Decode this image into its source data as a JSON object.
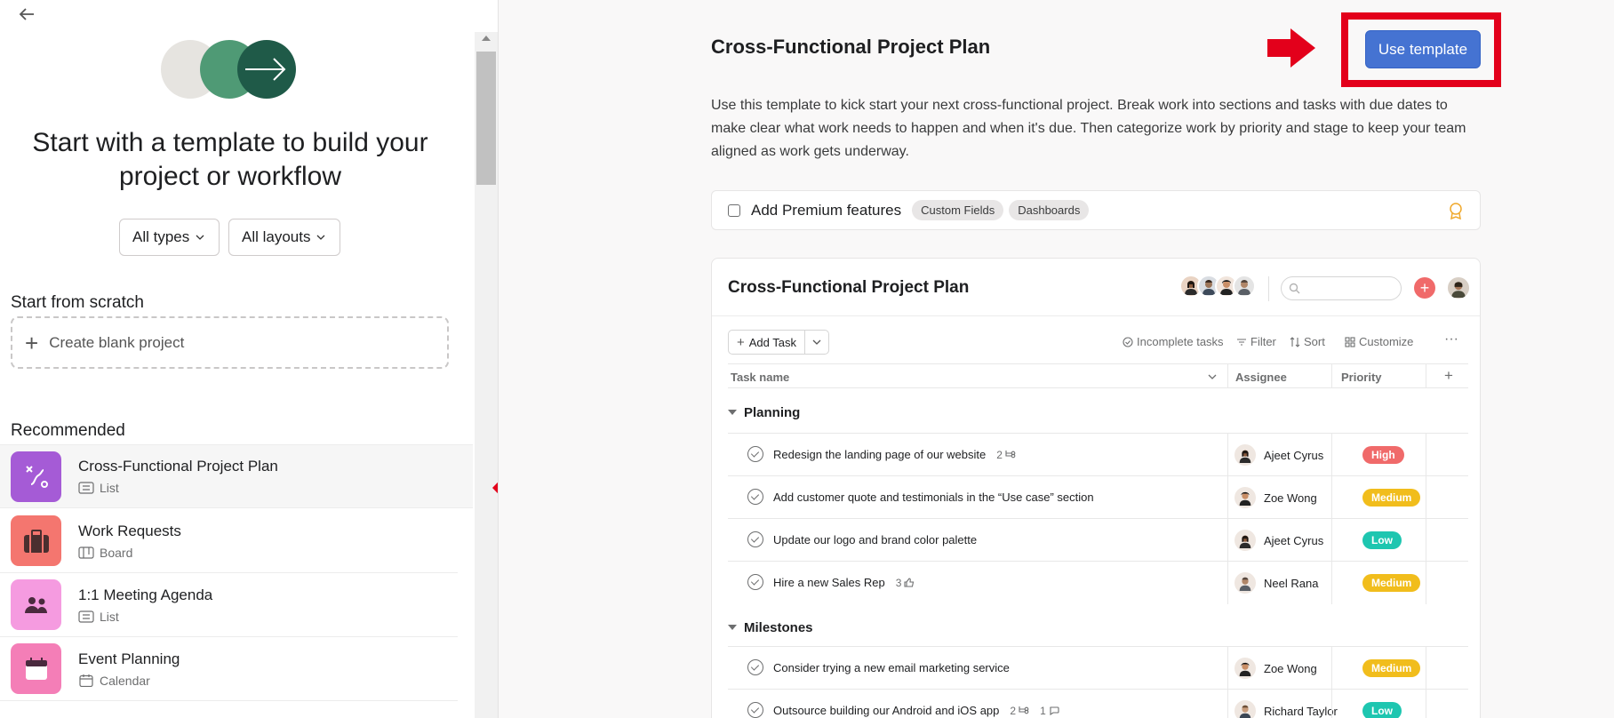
{
  "left": {
    "back_label": "Back",
    "hero_title": "Start with a template to build your project or workflow",
    "filter_types": "All types",
    "filter_layouts": "All layouts",
    "scratch_title": "Start from scratch",
    "blank_label": "Create blank project",
    "recommended_title": "Recommended",
    "templates": [
      {
        "name": "Cross-Functional Project Plan",
        "view": "List",
        "icon": "project-plan-icon",
        "color": "#a55bd6"
      },
      {
        "name": "Work Requests",
        "view": "Board",
        "icon": "briefcase-icon",
        "color": "#f4766f"
      },
      {
        "name": "1:1 Meeting Agenda",
        "view": "List",
        "icon": "people-icon",
        "color": "#f59be0"
      },
      {
        "name": "Event Planning",
        "view": "Calendar",
        "icon": "calendar-icon",
        "color": "#f47eb7"
      }
    ]
  },
  "detail": {
    "title": "Cross-Functional Project Plan",
    "use_template_label": "Use template",
    "description": "Use this template to kick start your next cross-functional project. Break work into sections and tasks with due dates to make clear what work needs to happen and when it's due. Then categorize work by priority and stage to keep your team aligned as work gets underway.",
    "premium_label": "Add Premium features",
    "premium_chips": [
      "Custom Fields",
      "Dashboards"
    ]
  },
  "preview": {
    "title": "Cross-Functional Project Plan",
    "add_task_label": "Add Task",
    "tools": [
      "Incomplete tasks",
      "Filter",
      "Sort",
      "Customize"
    ],
    "columns": [
      "Task name",
      "Assignee",
      "Priority"
    ],
    "sections": [
      {
        "name": "Planning",
        "tasks": [
          {
            "name": "Redesign the landing page of our website",
            "meta": "2",
            "meta_icon": "subtask-icon",
            "meta2": "",
            "assignee": "Ajeet Cyrus",
            "priority": "High",
            "priority_color": "#f06a6a"
          },
          {
            "name": "Add customer quote and testimonials in the “Use case” section",
            "meta": "",
            "meta_icon": "",
            "meta2": "",
            "assignee": "Zoe Wong",
            "priority": "Medium",
            "priority_color": "#f1bd1c"
          },
          {
            "name": "Update our logo and brand color palette",
            "meta": "",
            "meta_icon": "",
            "meta2": "",
            "assignee": "Ajeet Cyrus",
            "priority": "Low",
            "priority_color": "#1ec6b0"
          },
          {
            "name": "Hire a new Sales Rep",
            "meta": "3",
            "meta_icon": "like-icon",
            "meta2": "",
            "assignee": "Neel Rana",
            "priority": "Medium",
            "priority_color": "#f1bd1c"
          }
        ]
      },
      {
        "name": "Milestones",
        "tasks": [
          {
            "name": "Consider trying a new email marketing service",
            "meta": "",
            "meta_icon": "",
            "meta2": "",
            "assignee": "Zoe Wong",
            "priority": "Medium",
            "priority_color": "#f1bd1c"
          },
          {
            "name": "Outsource building our Android and iOS app",
            "meta": "2",
            "meta_icon": "subtask-icon",
            "meta2": "1",
            "assignee": "Richard Taylor",
            "priority": "Low",
            "priority_color": "#1ec6b0"
          }
        ]
      }
    ]
  },
  "colors": {
    "accent": "#4573d2",
    "highlight": "#e3001b"
  }
}
